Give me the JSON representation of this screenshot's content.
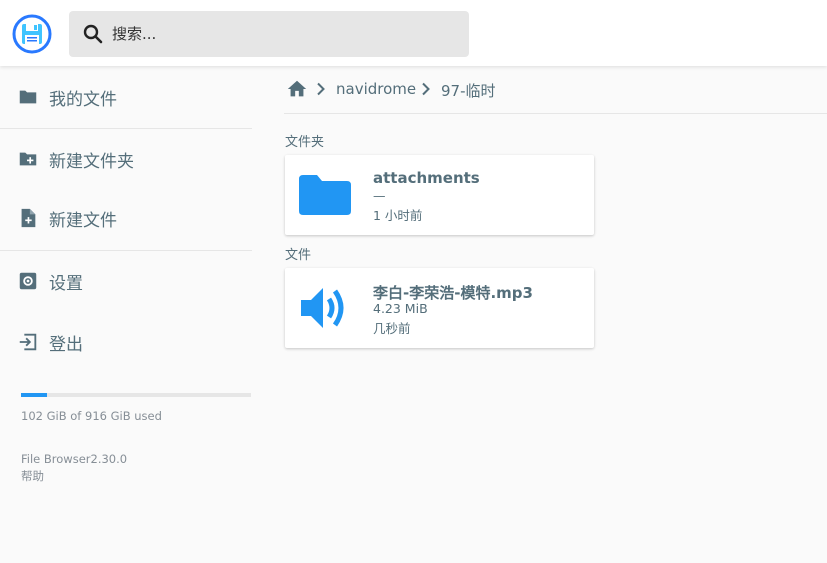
{
  "colors": {
    "accent": "#2196f3",
    "text": "#546e7a",
    "background": "#fafafa"
  },
  "header": {
    "logo_icon": "floppy-disk-icon",
    "search": {
      "placeholder": "搜索...",
      "value": "",
      "icon": "search-icon"
    }
  },
  "sidebar": {
    "items": [
      {
        "label": "我的文件",
        "icon": "folder-icon"
      },
      {
        "label": "新建文件夹",
        "icon": "create-folder-icon"
      },
      {
        "label": "新建文件",
        "icon": "note-add-icon"
      },
      {
        "label": "设置",
        "icon": "settings-icon"
      },
      {
        "label": "登出",
        "icon": "exit-icon"
      }
    ],
    "usage": {
      "text": "102 GiB of 916 GiB used",
      "used_gib": 102,
      "total_gib": 916
    },
    "version": "File Browser2.30.0",
    "help": "帮助"
  },
  "breadcrumbs": {
    "home_icon": "home-icon",
    "items": [
      {
        "label": "navidrome"
      },
      {
        "label": "97-临时"
      }
    ]
  },
  "listing": {
    "folders_title": "文件夹",
    "files_title": "文件",
    "folders": [
      {
        "name": "attachments",
        "size": "—",
        "modified": "1 小时前",
        "icon": "folder-icon"
      }
    ],
    "files": [
      {
        "name": "李白-李荣浩-模特.mp3",
        "size": "4.23 MiB",
        "modified": "几秒前",
        "icon": "volume-up-icon"
      }
    ]
  }
}
